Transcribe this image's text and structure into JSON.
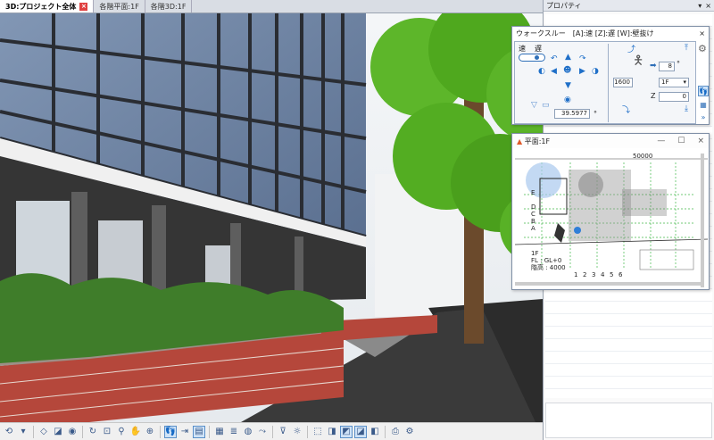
{
  "tabs": [
    {
      "label": "3D:プロジェクト全体",
      "active": true
    },
    {
      "label": "各階平面:1F",
      "active": false
    },
    {
      "label": "各階3D:1F",
      "active": false
    }
  ],
  "properties": {
    "title": "プロパティ",
    "pin": "▾",
    "close": "×"
  },
  "walkthrough": {
    "title": "ウォークスルー　[A]:速 [Z]:遅 [W]:壁抜け",
    "speed_fast": "速",
    "speed_slow": "遅",
    "eye_height": "1600",
    "step": "8",
    "step_unit": "°",
    "floor": "1F",
    "z_label": "Z",
    "z_value": "0",
    "angle": "39.5977",
    "angle_unit": "°",
    "close": "×"
  },
  "plan": {
    "title": "平面:1F",
    "dim_top": "50000",
    "floor_label": "1F",
    "fl_label": "FL : GL+0",
    "height_label": "階高 : 4000",
    "grid_x": [
      "1",
      "2",
      "3",
      "4",
      "5",
      "6"
    ],
    "grid_y": [
      "E",
      "D",
      "C",
      "B",
      "A"
    ],
    "minimize": "—",
    "maximize": "☐",
    "close": "×"
  },
  "colors": {
    "active_tab_close": "#e04040",
    "selection_blue": "#2f7fd8",
    "tree_green": "#4fa81e",
    "brick": "#b5473b"
  }
}
